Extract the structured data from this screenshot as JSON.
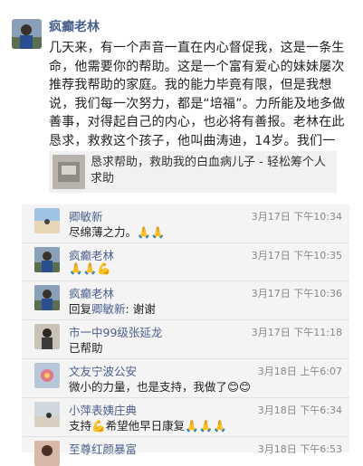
{
  "post": {
    "author": "疯癫老林",
    "body": "几天来，有一个声音一直在内心督促我，这是一条生命，他需要你的帮助。这是一个富有爱心的妹妹屡次推荐我帮助的家庭。我的能力毕竟有限，但是我想说，我们每一次努力，都是“培福”。力所能及地多做善事，对得起自己的内心，也必将有善报。老林在此恳求，救救这个孩子，他叫曲涛迪，14岁。我们一起让他活下去！",
    "link_title": "恳求帮助，救助我的白血病儿子 - 轻松筹个人求助"
  },
  "comments": [
    {
      "name": "卿敏新",
      "time": "3月17日 下午10:34",
      "text": "尽绵薄之力。🙏🙏",
      "avatar": "beach-photo-avatar"
    },
    {
      "name": "疯癫老林",
      "time": "3月17日 下午10:35",
      "text": "🙏🙏💪",
      "avatar": "person-photo-avatar"
    },
    {
      "name": "疯癫老林",
      "time": "3月17日 下午10:36",
      "reply_prefix": "回复",
      "reply_to": "卿敏新",
      "reply_text": ": 谢谢",
      "avatar": "person-photo-avatar"
    },
    {
      "name": "市一中99级张延龙",
      "time": "3月17日 下午11:18",
      "text": "已帮助",
      "avatar": "man-photo-avatar"
    },
    {
      "name": "文友宁波公安",
      "time": "3月18日 上午6:07",
      "text": "微小的力量，也是支持，我做了😊😊",
      "avatar": "flower-photo-avatar"
    },
    {
      "name": "小萍表姨庄典",
      "time": "3月18日 下午6:34",
      "text": "支持💪希望他早日康复🙏🙏🙏",
      "avatar": "landscape-photo-avatar"
    },
    {
      "name": "至尊红颜暴富",
      "time": "3月18日 下午6:53",
      "text": "",
      "avatar": "portrait-photo-avatar"
    }
  ]
}
